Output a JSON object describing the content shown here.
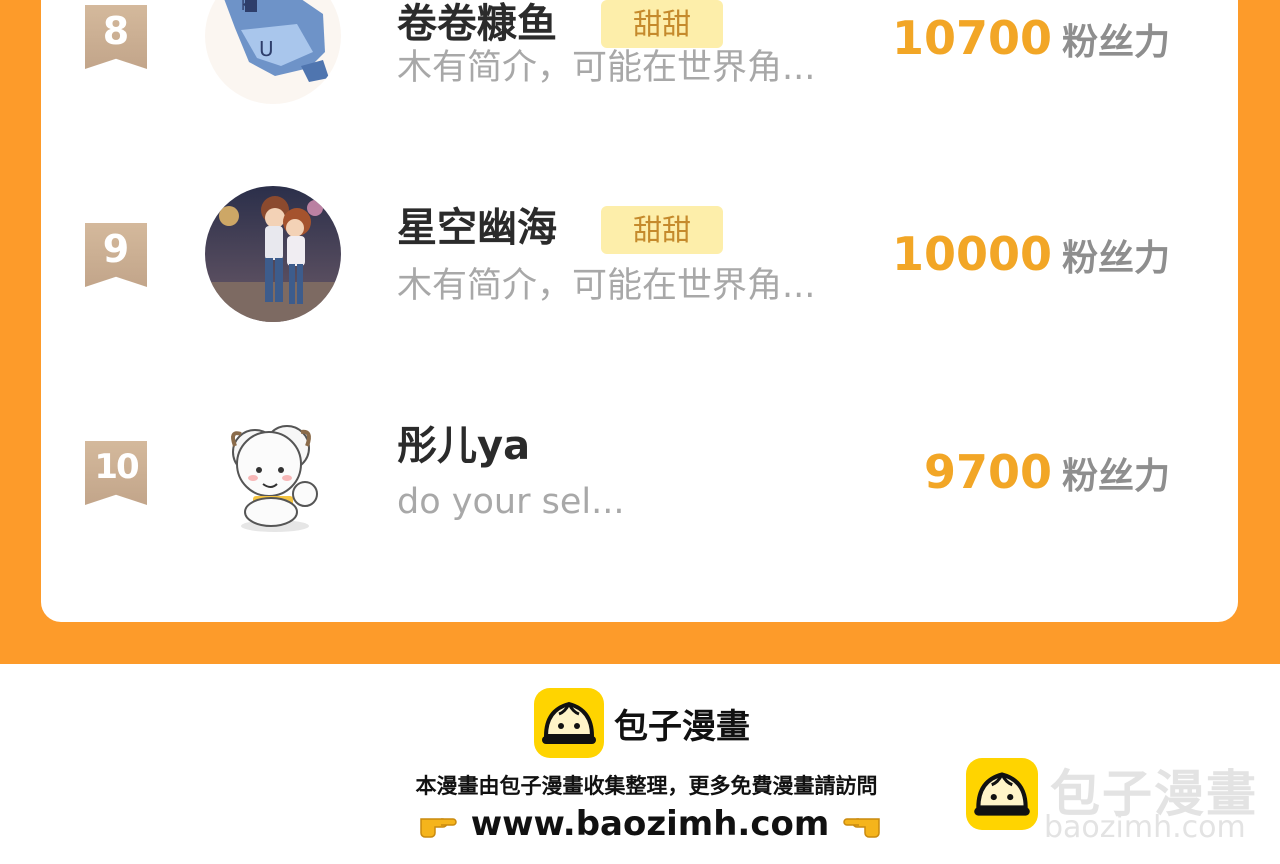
{
  "ranking": {
    "rows": [
      {
        "rank": "8",
        "name": "卷卷糠鱼",
        "tag": "甜甜",
        "desc": "木有简介，可能在世界角...",
        "score": "10700",
        "unit": "粉丝力",
        "avatar_icon": "pixel-shark-avatar"
      },
      {
        "rank": "9",
        "name": "星空幽海",
        "tag": "甜甜",
        "desc": "木有简介，可能在世界角...",
        "score": "10000",
        "unit": "粉丝力",
        "avatar_icon": "anime-couple-avatar"
      },
      {
        "rank": "10",
        "name": "彤儿ya",
        "tag": "",
        "desc": "do your sel...",
        "score": "9700",
        "unit": "粉丝力",
        "avatar_icon": "sheep-avatar"
      }
    ]
  },
  "footer": {
    "brand": "包子漫畫",
    "note": "本漫畫由包子漫畫收集整理，更多免費漫畫請訪問",
    "url": "www.baozimh.com",
    "icon": "bun-logo-icon",
    "pointer_icon": "pointing-hand-icon"
  },
  "watermark": {
    "title": "包子漫畫",
    "subtitle": "baozimh.com"
  },
  "colors": {
    "page_border": "#FD9B2A",
    "score": "#F2A626",
    "tag_bg": "#FDEEAA",
    "tag_text": "#C58A2C",
    "rank_badge": "#C9AC90",
    "brand_yellow": "#FFD400"
  }
}
